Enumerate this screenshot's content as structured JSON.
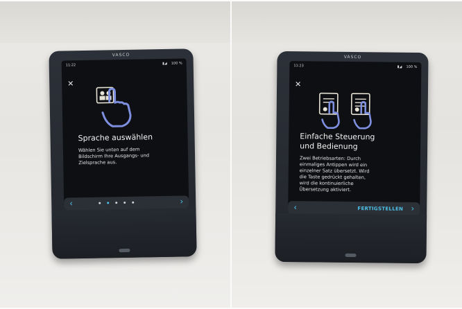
{
  "left": {
    "brand": "VASCO",
    "status_time": "11:22",
    "status_battery": "100 %",
    "close_symbol": "✕",
    "title": "Sprache auswählen",
    "body_lines": [
      "Wählen Sie unten auf dem",
      "Bildschirm Ihre Ausgangs- und",
      "Zielsprache aus."
    ],
    "nav_prev": "‹",
    "nav_next": "›",
    "dots_total": 5,
    "dots_active_index": 1
  },
  "right": {
    "brand": "VASCO",
    "status_time": "11:23",
    "status_battery": "100 %",
    "close_symbol": "✕",
    "title_lines": [
      "Einfache Steuerung",
      "und Bedienung"
    ],
    "body_lines": [
      "Zwei Betriebsarten: Durch",
      "einmaliges Antippen wird ein",
      "einzelner Satz übersetzt. Wird",
      "die Taste gedrückt gehalten,",
      "wird die kontinuierliche",
      "Übersetzung aktiviert."
    ],
    "nav_prev": "‹",
    "nav_next": "›",
    "finish_label": "FERTIGSTELLEN"
  },
  "colors": {
    "accent": "#4fc2ea",
    "device": "#23262c",
    "screen": "#0e0f12"
  }
}
